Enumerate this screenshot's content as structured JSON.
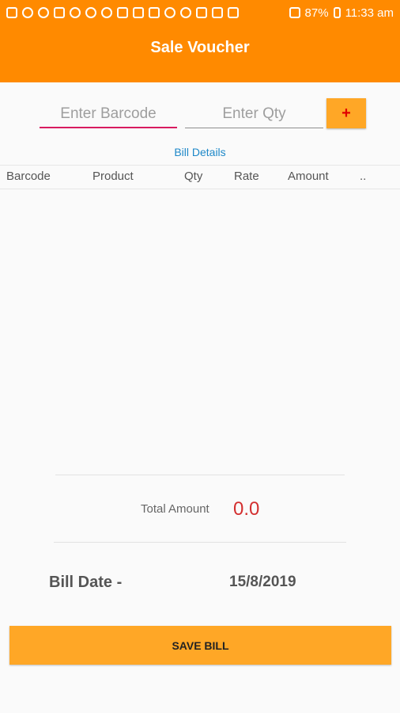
{
  "status_bar": {
    "battery": "87%",
    "time": "11:33 am",
    "icons": [
      "warning-icon",
      "telegram-icon",
      "sync-icon",
      "youtube-icon",
      "tiktok-icon",
      "tiktok-icon",
      "leaf-icon",
      "b-icon",
      "image-icon",
      "message-icon",
      "wrench-icon",
      "call-icon",
      "volte-icon",
      "sim-icon",
      "lte-icon",
      "signal-icon",
      "battery-icon"
    ]
  },
  "app_bar": {
    "title": "Sale Voucher"
  },
  "form": {
    "barcode_placeholder": "Enter Barcode",
    "qty_placeholder": "Enter Qty",
    "add_label": "+"
  },
  "bill_details_label": "Bill Details",
  "table": {
    "columns": [
      "Barcode",
      "Product",
      "Qty",
      "Rate",
      "Amount",
      ".."
    ],
    "rows": []
  },
  "totals": {
    "label": "Total Amount",
    "value": "0.0"
  },
  "bill_date": {
    "label": "Bill Date -",
    "value": "15/8/2019"
  },
  "save_button": "SAVE BILL",
  "colors": {
    "primary": "#ff8a00",
    "accent": "#ffa726",
    "total": "#d32f2f",
    "link": "#1e88c8"
  }
}
